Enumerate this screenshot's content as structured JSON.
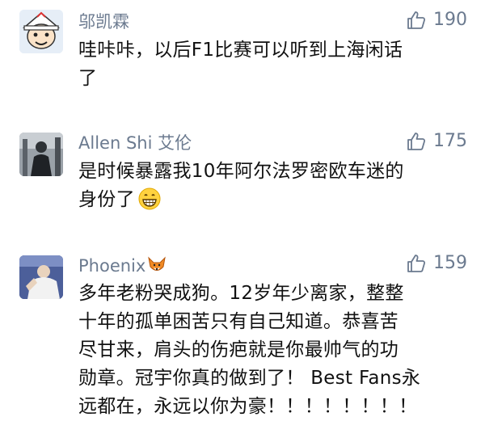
{
  "comments": [
    {
      "author": "邬凯霖",
      "likes": "190",
      "text_lines": [
        "哇咔咔，以后F1比赛可以听到上海闲话",
        "了"
      ],
      "avatar_icon": "cartoon-character-avatar"
    },
    {
      "author": "Allen Shi 艾伦",
      "likes": "175",
      "text_lines": [
        "是时候暴露我10年阿尔法罗密欧车迷的",
        "身份了"
      ],
      "trailing_emoji": "grinning-face-emoji",
      "avatar_icon": "photo-avatar"
    },
    {
      "author": "Phoenix",
      "author_emoji": "fox-emoji",
      "likes": "159",
      "text_lines": [
        "多年老粉哭成狗。12岁年少离家，整整",
        "十年的孤单困苦只有自己知道。恭喜苦",
        "尽甘来，肩头的伤疤就是你最帅气的功",
        "勋章。冠宇你真的做到了！ Best Fans永",
        "远都在，永远以你为豪！！！！！！！！"
      ],
      "avatar_icon": "photo-avatar"
    }
  ],
  "colors": {
    "meta": "#6b7a8f",
    "text": "#111111"
  }
}
